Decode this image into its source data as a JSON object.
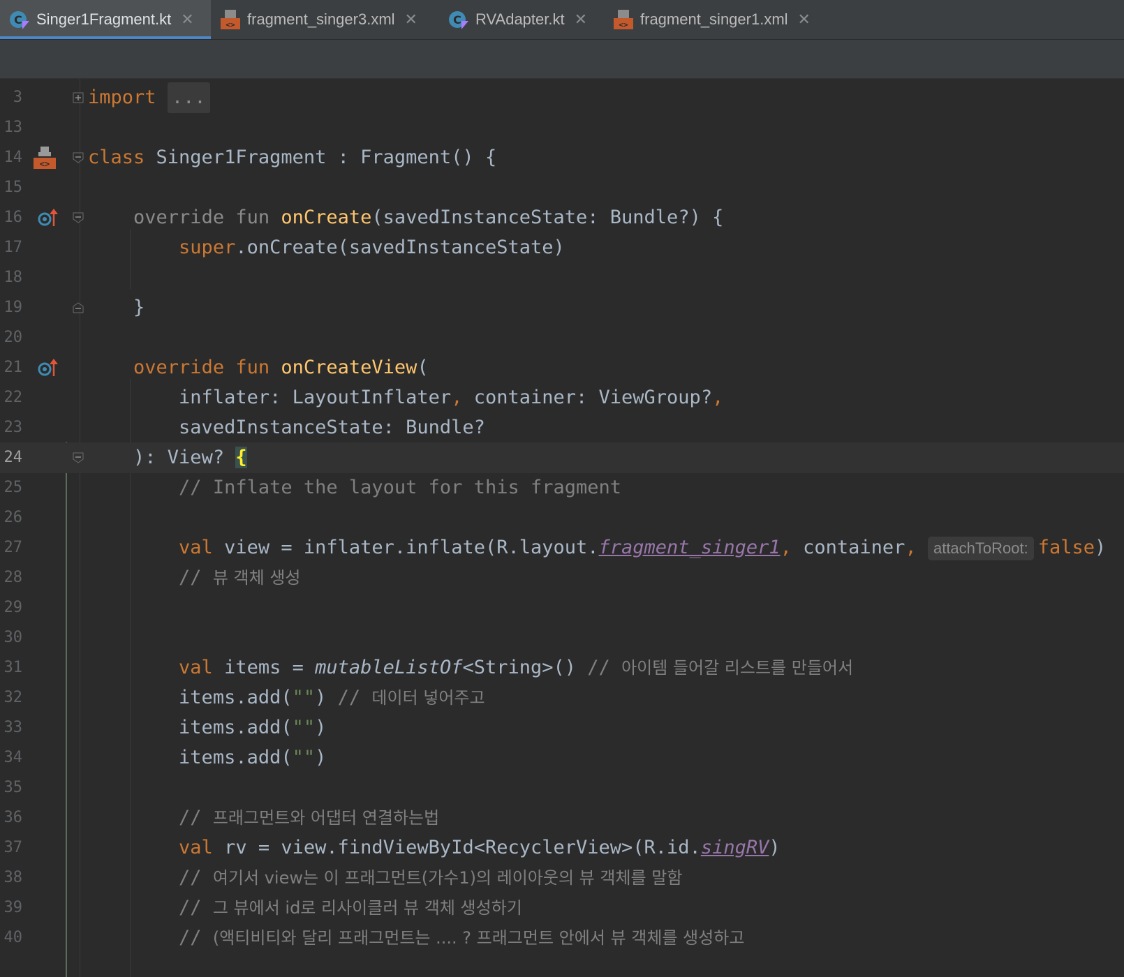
{
  "tabs": [
    {
      "label": "Singer1Fragment.kt",
      "icon": "kotlin-class-icon",
      "active": true
    },
    {
      "label": "fragment_singer3.xml",
      "icon": "layout-xml-icon",
      "active": false
    },
    {
      "label": "RVAdapter.kt",
      "icon": "kotlin-class-icon",
      "active": false
    },
    {
      "label": "fragment_singer1.xml",
      "icon": "layout-xml-icon",
      "active": false
    }
  ],
  "close_glyph": "✕",
  "editor": {
    "current_line": "24",
    "lines": [
      {
        "num": "3"
      },
      {
        "num": "13"
      },
      {
        "num": "14"
      },
      {
        "num": "15"
      },
      {
        "num": "16"
      },
      {
        "num": "17"
      },
      {
        "num": "18"
      },
      {
        "num": "19"
      },
      {
        "num": "20"
      },
      {
        "num": "21"
      },
      {
        "num": "22"
      },
      {
        "num": "23"
      },
      {
        "num": "24"
      },
      {
        "num": "25"
      },
      {
        "num": "26"
      },
      {
        "num": "27"
      },
      {
        "num": "28"
      },
      {
        "num": "29"
      },
      {
        "num": "30"
      },
      {
        "num": "31"
      },
      {
        "num": "32"
      },
      {
        "num": "33"
      },
      {
        "num": "34"
      },
      {
        "num": "35"
      },
      {
        "num": "36"
      },
      {
        "num": "37"
      },
      {
        "num": "38"
      },
      {
        "num": "39"
      },
      {
        "num": "40"
      }
    ],
    "code": {
      "l3_kw": "import",
      "l3_fold": "...",
      "l14_kw": "class",
      "l14_rest": " Singer1Fragment : Fragment() {",
      "l16_kw": "override fun",
      "l16_fn": "onCreate",
      "l16_rest": "(savedInstanceState: Bundle?) {",
      "l17_kw": "super",
      "l17_rest": ".onCreate(savedInstanceState)",
      "l19": "}",
      "l21_kw": "override fun",
      "l21_fn": "onCreateView",
      "l21_rest": "(",
      "l22_a": "inflater: LayoutInflater",
      "l22_b": ",",
      "l22_c": " container: ViewGroup?",
      "l22_d": ",",
      "l23": "savedInstanceState: Bundle?",
      "l24_a": "): View? ",
      "l24_brace": "{",
      "l25": "// Inflate the layout for this fragment",
      "l27_kw": "val",
      "l27_a": " view = inflater.inflate(R.layout.",
      "l27_ref": "fragment_singer1",
      "l27_comma1": ",",
      "l27_b": " container",
      "l27_comma2": ",",
      "l27_hint": "attachToRoot:",
      "l27_false": "false",
      "l27_end": ")",
      "l28_slash": "// ",
      "l28_kor": "뷰 객체 생성",
      "l31_kw": "val",
      "l31_a": " items = ",
      "l31_fn": "mutableListOf",
      "l31_b": "<String>() ",
      "l31_cm": "// ",
      "l31_kor": "아이템 들어갈 리스트를 만들어서",
      "l32_a": "items.add(",
      "l32_str": "\"\"",
      "l32_b": ") ",
      "l32_cm": "// ",
      "l32_kor": "데이터 넣어주고",
      "l33_a": "items.add(",
      "l33_str": "\"\"",
      "l33_b": ")",
      "l34_a": "items.add(",
      "l34_str": "\"\"",
      "l34_b": ")",
      "l36_cm": "// ",
      "l36_kor": "프래그먼트와 어댑터 연결하는법",
      "l37_kw": "val",
      "l37_a": " rv = view.findViewById<RecyclerView>(R.id.",
      "l37_ref": "singRV",
      "l37_b": ")",
      "l38_cm": "// ",
      "l38_kor": "여기서 view는 이 프래그먼트(가수1)의 레이아웃의 뷰 객체를 말함",
      "l39_cm": "// ",
      "l39_kor": "그 뷰에서 id로 리사이클러 뷰 객체 생성하기",
      "l40_cm": "// ",
      "l40_kor": "(액티비티와 달리 프래그먼트는 .... ? 프래그먼트 안에서 뷰 객체를 생성하고"
    }
  },
  "colors": {
    "keyword": "#cc7832",
    "function": "#ffc66d",
    "comment": "#808080",
    "default": "#a9b7c6",
    "reference": "#9876aa",
    "active_tab_underline": "#4a88c7"
  }
}
